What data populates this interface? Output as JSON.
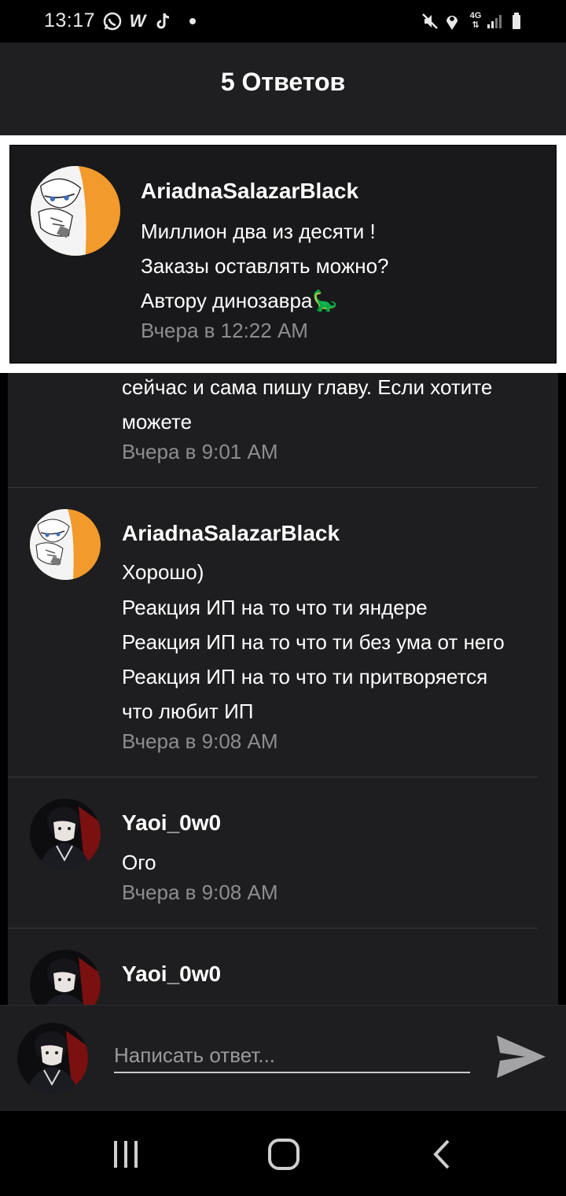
{
  "status": {
    "time": "13:17",
    "left_icons": [
      "whatsapp-icon",
      "w-app-icon",
      "tiktok-icon",
      "dot-icon"
    ],
    "right_icons": [
      "mute-icon",
      "location-icon",
      "network-4g-icon",
      "signal-icon",
      "battery-icon"
    ]
  },
  "header": {
    "title": "5 Ответов"
  },
  "parent_comment": {
    "author": "AriadnaSalazarBlack",
    "lines": [
      "Миллион два из десяти !",
      "Заказы оставлять можно?",
      "Автору динозавра🦕"
    ],
    "time": "Вчера в 12:22 AM"
  },
  "replies": [
    {
      "lines": [
        "сейчас и сама пишу главу. Если хотите",
        "можете"
      ],
      "time": "Вчера в 9:01 AM"
    },
    {
      "author": "AriadnaSalazarBlack",
      "lines": [
        "Хорошо)",
        "Реакция ИП на то что ти яндере",
        "Реакция ИП на то что ти без ума от него",
        "Реакция ИП на то что ти притворяется",
        "что любит ИП"
      ],
      "time": "Вчера в 9:08 AM"
    },
    {
      "author": "Yaoi_0w0",
      "lines": [
        "Ого"
      ],
      "time": "Вчера в 9:08 AM"
    },
    {
      "author": "Yaoi_0w0"
    }
  ],
  "reply_bar": {
    "placeholder": "Написать ответ..."
  },
  "nav": [
    "recent-apps-icon",
    "home-icon",
    "back-icon"
  ],
  "colors": {
    "background": "#1e1e20",
    "header": "#1f1f21",
    "timestamp": "#8d8d90",
    "avatar_orange": "#f39a2c"
  }
}
